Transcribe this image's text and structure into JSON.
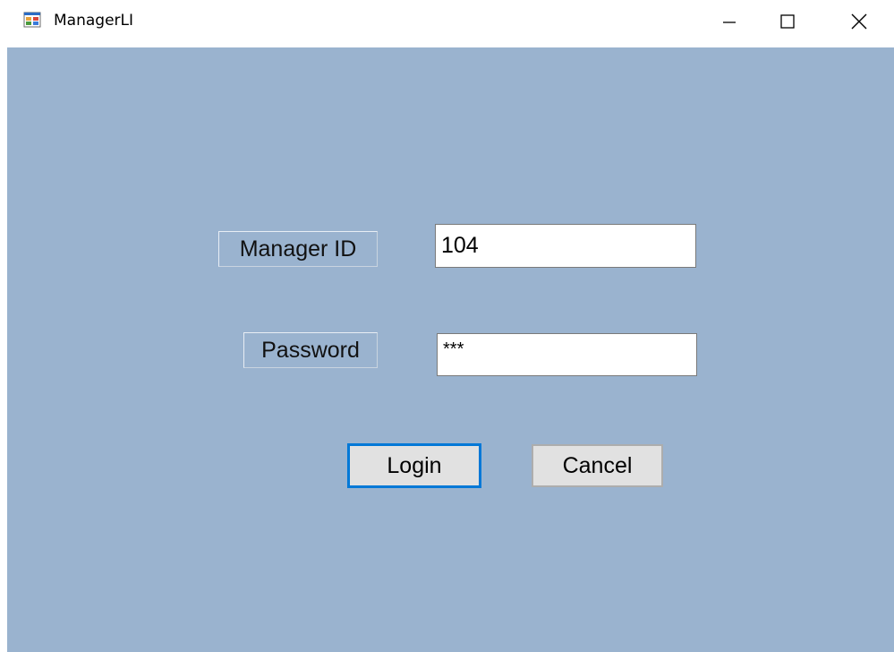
{
  "window": {
    "title": "ManagerLI",
    "controls": {
      "minimize_icon": "minimize-icon",
      "maximize_icon": "maximize-icon",
      "close_icon": "close-icon"
    }
  },
  "form": {
    "manager_id_label": "Manager ID",
    "manager_id_value": "104",
    "password_label": "Password",
    "password_value": "***",
    "login_button": "Login",
    "cancel_button": "Cancel"
  },
  "colors": {
    "client_background": "#9ab3cf",
    "focus_border": "#0078d7",
    "button_face": "#e1e1e1"
  }
}
